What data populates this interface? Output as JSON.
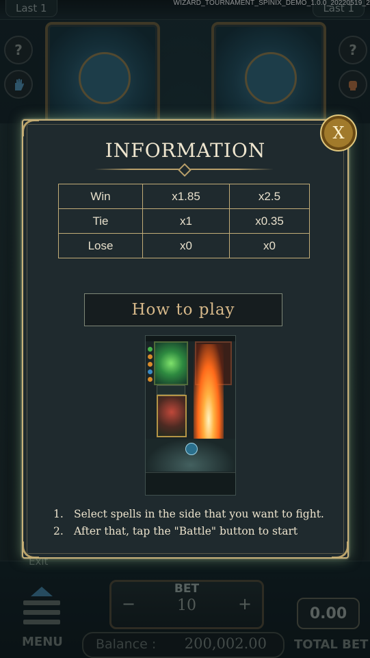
{
  "game": {
    "version": "WIZARD_TOURNAMENT_SPINIX_DEMO_1.0.0_20220519_2",
    "last_left": "Last 1",
    "last_right": "Last 1",
    "help_left": "?",
    "help_right": "?",
    "exit_label": "Exit",
    "menu_label": "MENU",
    "bet_label": "BET",
    "bet_value": "10",
    "bet_minus": "−",
    "bet_plus": "+",
    "total_bet_value": "0.00",
    "total_bet_label": "TOTAL BET",
    "balance_label": "Balance :",
    "balance_value": "200,002.00"
  },
  "modal": {
    "title": "INFORMATION",
    "close_label": "X",
    "payout_table": [
      [
        "Win",
        "x1.85",
        "x2.5"
      ],
      [
        "Tie",
        "x1",
        "x0.35"
      ],
      [
        "Lose",
        "x0",
        "x0"
      ]
    ],
    "how_to_play_label": "How to play",
    "instructions": [
      {
        "num": "1.",
        "text": "Select spells in the side that  you want to fight."
      },
      {
        "num": "2.",
        "text": "After that, tap the \"Battle\" button to start"
      }
    ]
  },
  "colors": {
    "modal_border": "#c9b27a",
    "modal_bg": "#1f2a2e",
    "close_button": "#a17a2b",
    "how_to_play_text": "#d7b98a"
  },
  "icons": {
    "help_left": "question-icon",
    "help_right": "question-icon",
    "spell_left": "hand-spell-icon",
    "spell_right": "fist-spell-icon",
    "menu": "hamburger-menu-icon"
  }
}
